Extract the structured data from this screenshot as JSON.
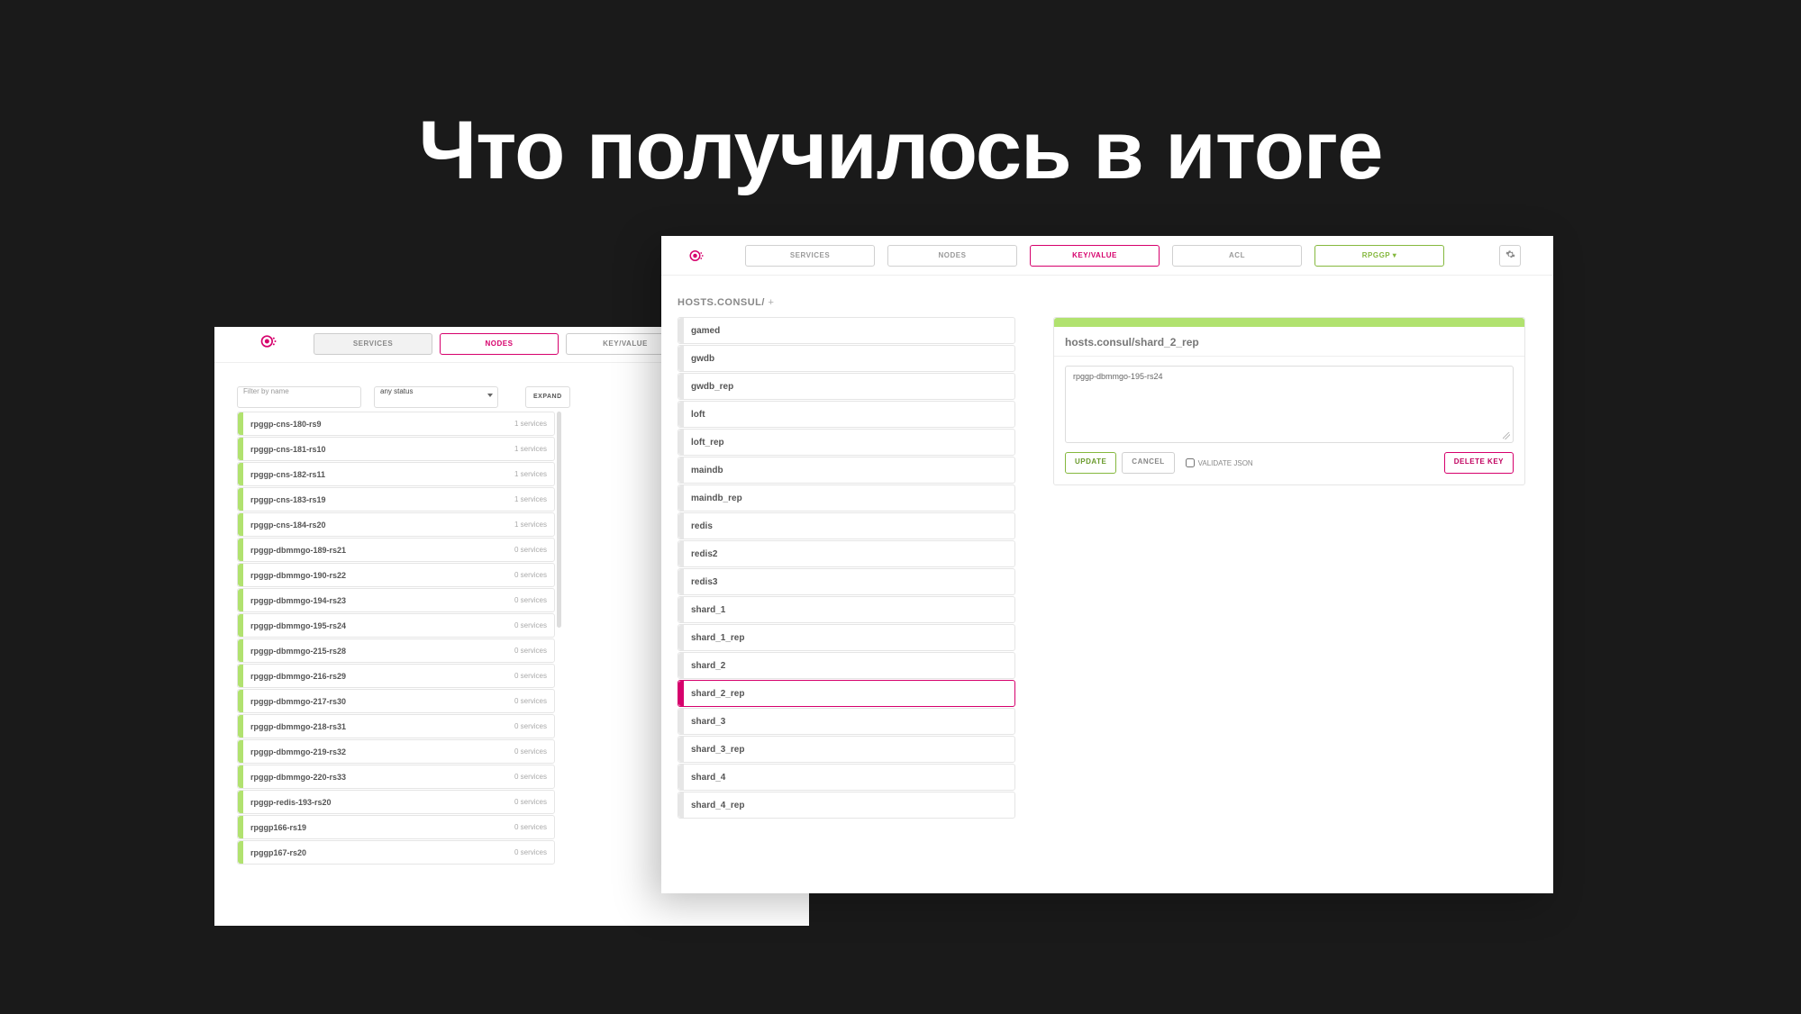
{
  "slide_title": "Что получилось в итоге",
  "back_pane": {
    "tabs": {
      "services": "SERVICES",
      "nodes": "NODES",
      "kv": "KEY/VALUE"
    },
    "filter_placeholder": "Filter by name",
    "status_select": "any status",
    "expand": "EXPAND",
    "nodes": [
      {
        "name": "rpggp-cns-180-rs9",
        "meta": "1 services"
      },
      {
        "name": "rpggp-cns-181-rs10",
        "meta": "1 services"
      },
      {
        "name": "rpggp-cns-182-rs11",
        "meta": "1 services"
      },
      {
        "name": "rpggp-cns-183-rs19",
        "meta": "1 services"
      },
      {
        "name": "rpggp-cns-184-rs20",
        "meta": "1 services"
      },
      {
        "name": "rpggp-dbmmgo-189-rs21",
        "meta": "0 services"
      },
      {
        "name": "rpggp-dbmmgo-190-rs22",
        "meta": "0 services"
      },
      {
        "name": "rpggp-dbmmgo-194-rs23",
        "meta": "0 services"
      },
      {
        "name": "rpggp-dbmmgo-195-rs24",
        "meta": "0 services"
      },
      {
        "name": "rpggp-dbmmgo-215-rs28",
        "meta": "0 services"
      },
      {
        "name": "rpggp-dbmmgo-216-rs29",
        "meta": "0 services"
      },
      {
        "name": "rpggp-dbmmgo-217-rs30",
        "meta": "0 services"
      },
      {
        "name": "rpggp-dbmmgo-218-rs31",
        "meta": "0 services"
      },
      {
        "name": "rpggp-dbmmgo-219-rs32",
        "meta": "0 services"
      },
      {
        "name": "rpggp-dbmmgo-220-rs33",
        "meta": "0 services"
      },
      {
        "name": "rpggp-redis-193-rs20",
        "meta": "0 services"
      },
      {
        "name": "rpggp166-rs19",
        "meta": "0 services"
      },
      {
        "name": "rpggp167-rs20",
        "meta": "0 services"
      }
    ]
  },
  "front_pane": {
    "tabs": {
      "services": "SERVICES",
      "nodes": "NODES",
      "kv": "KEY/VALUE",
      "acl": "ACL",
      "dc": "RPGGP ▾"
    },
    "breadcrumb": "HOSTS.CONSUL/ ",
    "breadcrumb_plus": "+",
    "keys": [
      {
        "name": "gamed"
      },
      {
        "name": "gwdb"
      },
      {
        "name": "gwdb_rep"
      },
      {
        "name": "loft"
      },
      {
        "name": "loft_rep"
      },
      {
        "name": "maindb"
      },
      {
        "name": "maindb_rep"
      },
      {
        "name": "redis"
      },
      {
        "name": "redis2"
      },
      {
        "name": "redis3"
      },
      {
        "name": "shard_1"
      },
      {
        "name": "shard_1_rep"
      },
      {
        "name": "shard_2"
      },
      {
        "name": "shard_2_rep",
        "selected": true
      },
      {
        "name": "shard_3"
      },
      {
        "name": "shard_3_rep"
      },
      {
        "name": "shard_4"
      },
      {
        "name": "shard_4_rep"
      }
    ],
    "detail": {
      "title": "hosts.consul/shard_2_rep",
      "value": "rpggp-dbmmgo-195-rs24",
      "update": "UPDATE",
      "cancel": "CANCEL",
      "validate": "VALIDATE JSON",
      "delete": "DELETE KEY"
    }
  }
}
